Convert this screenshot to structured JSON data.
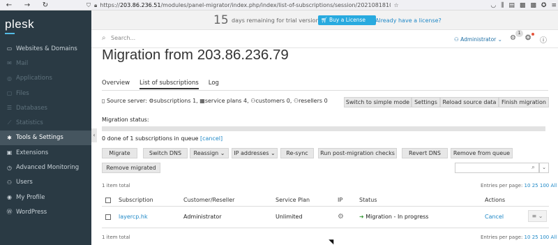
{
  "browser": {
    "url_prefix": "https://",
    "url_domain": "203.86.236.51",
    "url_path": "/modules/panel-migrator/index.php/index/list-of-subscriptions/session/20210818105840"
  },
  "sidebar": {
    "logo": "plesk",
    "items": [
      {
        "label": "Websites & Domains",
        "icon": "globe-icon",
        "state": "normal",
        "glyph": "▭"
      },
      {
        "label": "Mail",
        "icon": "mail-icon",
        "state": "dim",
        "glyph": "✉"
      },
      {
        "label": "Applications",
        "icon": "applications-icon",
        "state": "dim",
        "glyph": "◎"
      },
      {
        "label": "Files",
        "icon": "folder-icon",
        "state": "dim",
        "glyph": "▢"
      },
      {
        "label": "Databases",
        "icon": "database-icon",
        "state": "dim",
        "glyph": "☰"
      },
      {
        "label": "Statistics",
        "icon": "statistics-icon",
        "state": "dim",
        "glyph": "⟋"
      },
      {
        "label": "Tools & Settings",
        "icon": "tools-icon",
        "state": "active",
        "glyph": "✱"
      },
      {
        "label": "Extensions",
        "icon": "extensions-icon",
        "state": "normal",
        "glyph": "▣"
      },
      {
        "label": "Advanced Monitoring",
        "icon": "monitoring-icon",
        "state": "normal",
        "glyph": "◷"
      },
      {
        "label": "Users",
        "icon": "users-icon",
        "state": "normal",
        "glyph": "⚇"
      },
      {
        "label": "My Profile",
        "icon": "profile-icon",
        "state": "normal",
        "glyph": "◉"
      },
      {
        "label": "WordPress",
        "icon": "wordpress-icon",
        "state": "normal",
        "glyph": "Ⓦ"
      }
    ]
  },
  "trial": {
    "days": "15",
    "text": "days remaining for trial version",
    "buy": "Buy a License",
    "already": "Already have a license?"
  },
  "topbar": {
    "search_placeholder": "Search...",
    "user": "Administrator ⌄",
    "notifications_count": "1"
  },
  "page": {
    "title": "Migration from 203.86.236.79"
  },
  "tabs": [
    "Overview",
    "List of subscriptions",
    "Log"
  ],
  "source": {
    "prefix": "Source server:",
    "subs": "subscriptions 1,",
    "plans": "service plans 4,",
    "customers": "customers 0,",
    "resellers": "resellers 0"
  },
  "top_buttons": [
    "Switch to simple mode",
    "Settings",
    "Reload source data",
    "Finish migration"
  ],
  "migration": {
    "status_label": "Migration status:",
    "progress": 0,
    "queue_text": "0 done of 1 subscriptions in queue",
    "cancel": "[cancel]"
  },
  "actions": [
    "Migrate",
    "Switch DNS",
    "Reassign ⌄",
    "IP addresses ⌄",
    "Re-sync",
    "Run post-migration checks",
    "Revert DNS",
    "Remove from queue",
    "Remove migrated"
  ],
  "list": {
    "total": "1 item total",
    "entries_label": "Entries per page:",
    "entries": [
      "10",
      "25",
      "100",
      "All"
    ],
    "columns": [
      "Subscription",
      "Customer/Reseller",
      "Service Plan",
      "IP",
      "Status",
      "Actions"
    ],
    "rows": [
      {
        "subscription": "layercp.hk",
        "customer": "Administrator",
        "plan": "Unlimited",
        "status": "Migration - In progress",
        "action": "Cancel"
      }
    ]
  },
  "colors": {
    "sidebar": "#2a3a44",
    "accent": "#28aadf",
    "link": "#1e88c7"
  }
}
